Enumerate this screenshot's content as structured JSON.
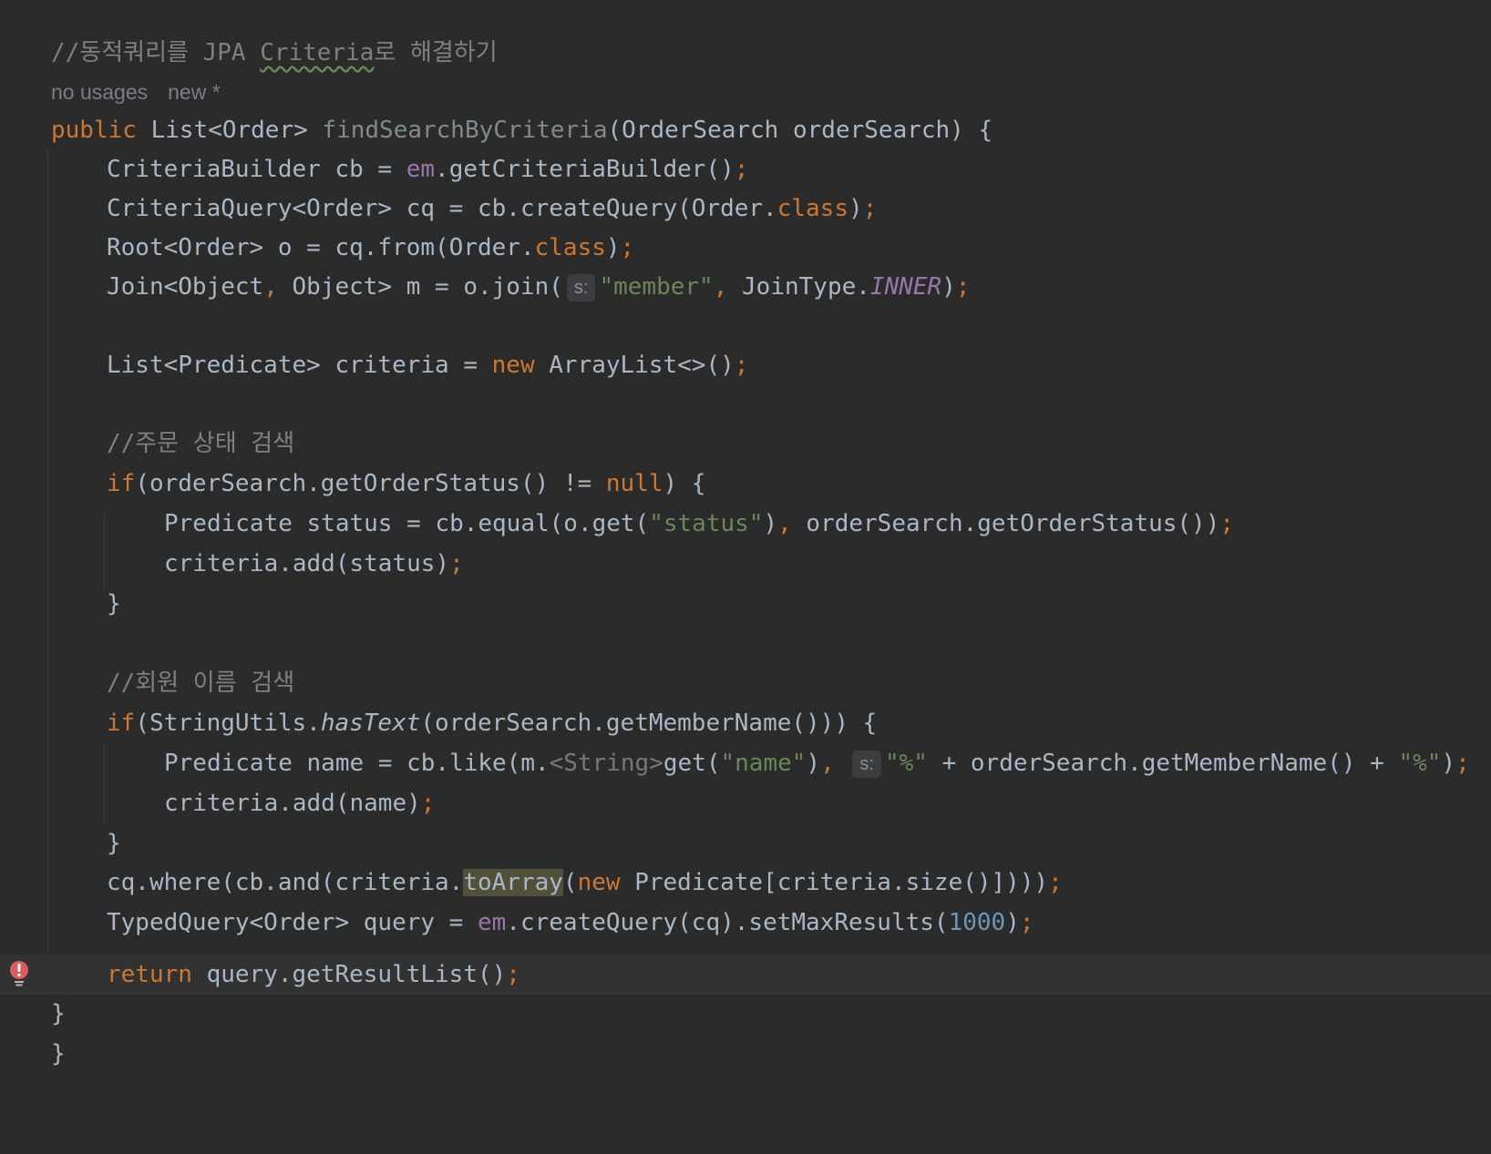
{
  "editor": {
    "comment_title": "//동적쿼리를 JPA Criteria로 해결하기",
    "inlay": {
      "usages": "no usages",
      "author": "new *"
    },
    "kw": {
      "public": "public",
      "new": "new",
      "if": "if",
      "return": "return",
      "null": "null",
      "class": "class"
    },
    "lines": {
      "sig_type": "List<Order> ",
      "sig_method": "findSearchByCriteria",
      "sig_params": "(OrderSearch orderSearch) {",
      "cb_decl": "CriteriaBuilder cb = ",
      "em": "em",
      "cb_call": ".getCriteriaBuilder()",
      "cq_decl": "CriteriaQuery<Order> cq = cb.createQuery(Order.",
      "root_decl": "Root<Order> o = cq.from(Order.",
      "join_a": "Join<Object",
      "join_b": " Object> m = o.join(",
      "hint_s": "s:",
      "str_member": "\"member\"",
      "join_c": " JoinType.",
      "join_inner": "INNER",
      "list_a": "List<Predicate> criteria = ",
      "list_b": " ArrayList<>()",
      "comment_status": "//주문 상태 검색",
      "if_status": "(orderSearch.getOrderStatus() != ",
      "if_status_end": ") {",
      "pred_status_a": "Predicate status = cb.equal(o.get(",
      "str_status": "\"status\"",
      "pred_status_b": ")",
      "pred_status_c": " orderSearch.getOrderStatus())",
      "add_status": "criteria.add(status)",
      "close_brace": "}",
      "comment_name": "//회원 이름 검색",
      "if_name_a": "(StringUtils.",
      "has_text": "hasText",
      "if_name_b": "(orderSearch.getMemberName())) {",
      "pred_name_a": "Predicate name = cb.like(m.",
      "type_string": "<String>",
      "pred_name_b": "get(",
      "str_name": "\"name\"",
      "pred_name_c": ")",
      "str_pct": "\"%\"",
      "pred_name_d": " + orderSearch.getMemberName() + ",
      "pred_name_e": ")",
      "add_name": "criteria.add(name)",
      "where_a": "cq.where(cb.and(criteria.",
      "to_array": "toArray",
      "where_b": "(",
      "where_c": " Predicate[criteria.size()])))",
      "typed_a": "TypedQuery<Order> query = ",
      "typed_b": ".createQuery(cq).setMaxResults(",
      "num_1000": "1000",
      "typed_c": ")",
      "return_b": " query.getResultList()",
      "semicolon": ";",
      "comma": ","
    }
  },
  "colors": {
    "background": "#2b2b2b",
    "keyword": "#cc7832",
    "comment": "#808080",
    "string": "#6a8759",
    "field": "#9876aa",
    "number": "#6897bb",
    "text": "#a9b7c6",
    "error": "#db5c5c"
  }
}
